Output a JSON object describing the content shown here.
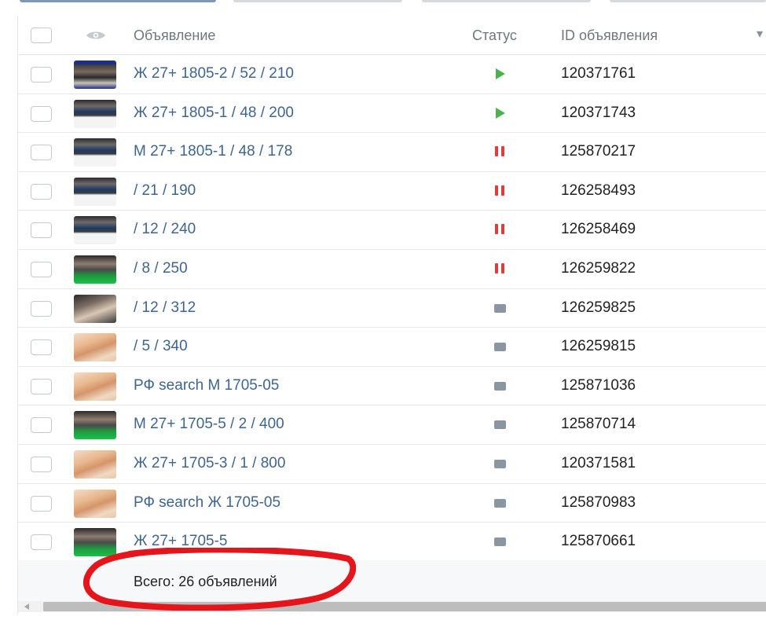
{
  "table": {
    "headers": {
      "ad": "Объявление",
      "status": "Статус",
      "id": "ID объявления"
    },
    "rows": [
      {
        "title": "Ж 27+ 1805-2 / 52 / 210",
        "status": "running",
        "id": "120371761",
        "thumb": "photo-a"
      },
      {
        "title": "Ж 27+ 1805-1 / 48 / 200",
        "status": "running",
        "id": "120371743",
        "thumb": "photo-b"
      },
      {
        "title": "М 27+ 1805-1 / 48 / 178",
        "status": "paused",
        "id": "125870217",
        "thumb": "photo-b"
      },
      {
        "title": "/ 21 / 190",
        "status": "paused",
        "id": "126258493",
        "thumb": "photo-b"
      },
      {
        "title": "/ 12 / 240",
        "status": "paused",
        "id": "126258469",
        "thumb": "photo-b"
      },
      {
        "title": "/ 8 / 250",
        "status": "paused",
        "id": "126259822",
        "thumb": "photo-green"
      },
      {
        "title": "/ 12 / 312",
        "status": "stopped",
        "id": "126259825",
        "thumb": "photo-dark"
      },
      {
        "title": "/ 5 / 340",
        "status": "stopped",
        "id": "126259815",
        "thumb": "photo-beige"
      },
      {
        "title": "РФ search М 1705-05",
        "status": "stopped",
        "id": "125871036",
        "thumb": "photo-beige"
      },
      {
        "title": "М 27+ 1705-5 / 2 / 400",
        "status": "stopped",
        "id": "125870714",
        "thumb": "photo-green"
      },
      {
        "title": "Ж 27+ 1705-3 / 1 / 800",
        "status": "stopped",
        "id": "120371581",
        "thumb": "photo-beige"
      },
      {
        "title": "РФ search Ж 1705-05",
        "status": "stopped",
        "id": "125870983",
        "thumb": "photo-beige"
      },
      {
        "title": "Ж 27+ 1705-5",
        "status": "stopped",
        "id": "125870661",
        "thumb": "photo-green"
      }
    ]
  },
  "footer": {
    "total": "Всего: 26 объявлений"
  },
  "colors": {
    "link": "#3f658f",
    "running": "#4bb34b",
    "paused": "#e03c3c",
    "stopped": "#8b96a3",
    "annotation": "#e5161b"
  },
  "icons": {
    "visibility_column": "eye-icon",
    "sort": "sort-arrow-icon"
  }
}
